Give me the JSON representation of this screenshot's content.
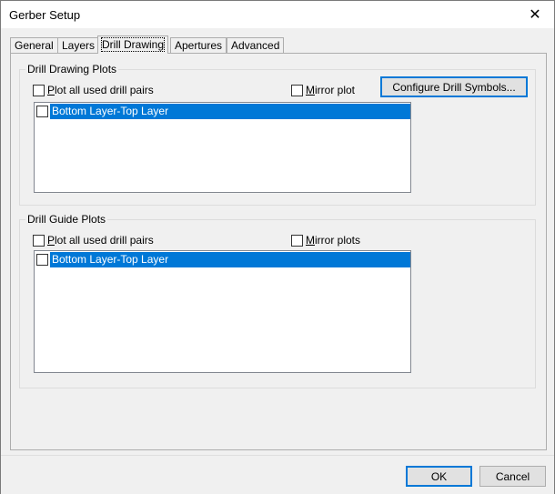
{
  "window": {
    "title": "Gerber Setup"
  },
  "tabs": [
    {
      "label": "General"
    },
    {
      "label": "Layers"
    },
    {
      "label": "Drill Drawing"
    },
    {
      "label": "Apertures"
    },
    {
      "label": "Advanced"
    }
  ],
  "drill_drawing_plots": {
    "title": "Drill Drawing Plots",
    "plot_all_first": "P",
    "plot_all_rest": "lot all used drill pairs",
    "mirror_first": "M",
    "mirror_rest": "irror plot",
    "configure_button": "Configure Drill Symbols...",
    "items": [
      {
        "label": "Bottom Layer-Top Layer"
      }
    ]
  },
  "drill_guide_plots": {
    "title": "Drill Guide Plots",
    "plot_all_first": "P",
    "plot_all_rest": "lot all used drill pairs",
    "mirror_first": "M",
    "mirror_rest": "irror plots",
    "items": [
      {
        "label": "Bottom Layer-Top Layer"
      }
    ]
  },
  "footer": {
    "ok_label": "OK",
    "cancel_label": "Cancel"
  },
  "colors": {
    "selection": "#0078d7",
    "default_button_border": "#0078d7"
  },
  "icons": {
    "close": "close-icon"
  }
}
